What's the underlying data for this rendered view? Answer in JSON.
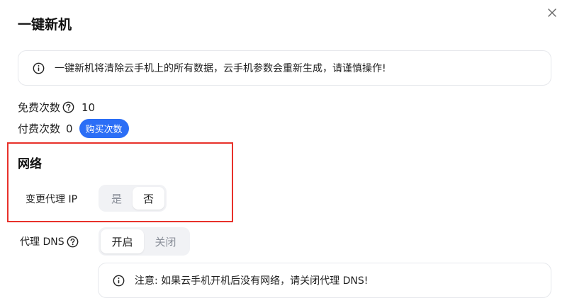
{
  "dialog": {
    "title": "一键新机",
    "close_icon": "close-icon"
  },
  "notice_top": {
    "icon": "info-icon",
    "text": "一键新机将清除云手机上的所有数据，云手机参数会重新生成，请谨慎操作!"
  },
  "stats": {
    "free_label": "免费次数",
    "free_value": "10",
    "paid_label": "付费次数",
    "paid_value": "0",
    "buy_label": "购买次数"
  },
  "network": {
    "section_title": "网络",
    "proxy_ip_label": "变更代理 IP",
    "proxy_ip_options": [
      "是",
      "否"
    ],
    "proxy_ip_selected": "否",
    "proxy_dns_label": "代理 DNS",
    "proxy_dns_options": [
      "开启",
      "关闭"
    ],
    "proxy_dns_selected": "开启"
  },
  "notice_bottom": {
    "icon": "info-icon",
    "text": "注意: 如果云手机开机后没有网络，请关闭代理 DNS!"
  },
  "colors": {
    "accent": "#2b6ef6",
    "highlight_border": "#e8312a",
    "segment_bg": "#f1f2f5"
  }
}
